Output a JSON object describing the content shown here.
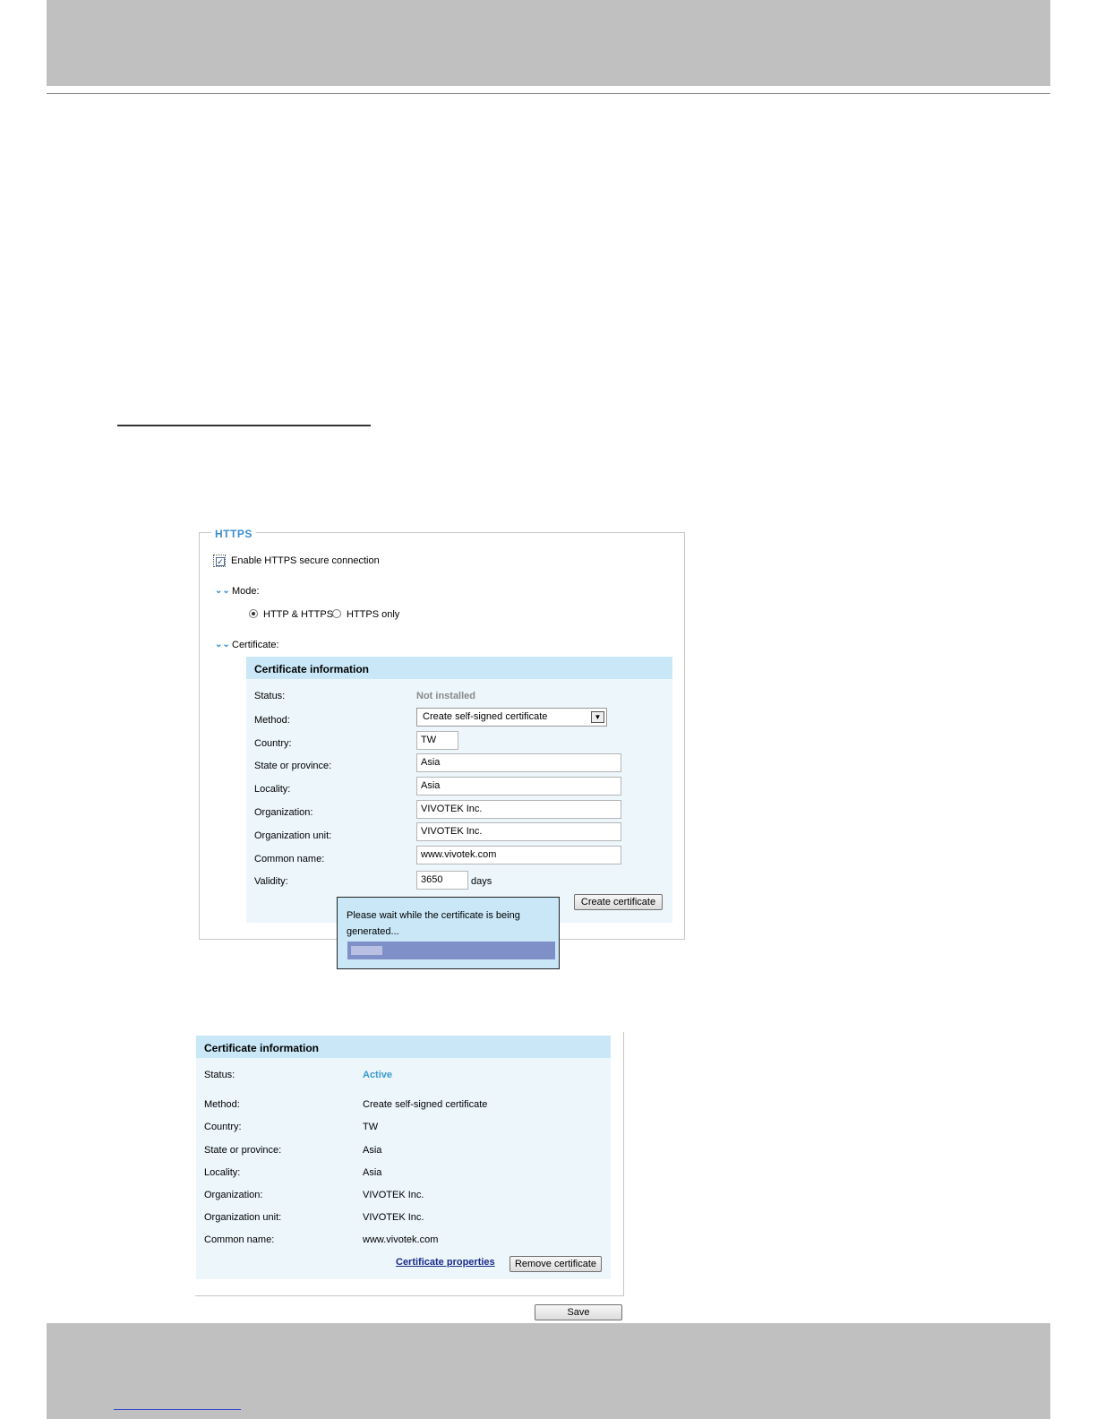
{
  "https": {
    "legend": "HTTPS",
    "enable_label": "Enable HTTPS secure connection",
    "enable_checked": true,
    "mode_label": "Mode:",
    "mode_options": [
      "HTTP & HTTPS",
      "HTTPS only"
    ],
    "mode_selected": "HTTP & HTTPS",
    "certificate_label": "Certificate:",
    "cert_info": {
      "title": "Certificate information",
      "status_label": "Status:",
      "status_value": "Not installed",
      "method_label": "Method:",
      "method_value": "Create self-signed certificate",
      "country_label": "Country:",
      "country_value": "TW",
      "state_label": "State or province:",
      "state_value": "Asia",
      "locality_label": "Locality:",
      "locality_value": "Asia",
      "org_label": "Organization:",
      "org_value": "VIVOTEK Inc.",
      "orgunit_label": "Organization unit:",
      "orgunit_value": "VIVOTEK Inc.",
      "common_label": "Common name:",
      "common_value": "www.vivotek.com",
      "validity_label": "Validity:",
      "validity_value": "3650",
      "validity_unit": "days",
      "create_button": "Create certificate"
    },
    "popup": {
      "line1": "Please wait while the certificate is being",
      "line2": "generated..."
    }
  },
  "cert_result": {
    "title": "Certificate information",
    "status_label": "Status:",
    "status_value": "Active",
    "method_label": "Method:",
    "method_value": "Create self-signed certificate",
    "country_label": "Country:",
    "country_value": "TW",
    "state_label": "State or province:",
    "state_value": "Asia",
    "locality_label": "Locality:",
    "locality_value": "Asia",
    "org_label": "Organization:",
    "org_value": "VIVOTEK Inc.",
    "orgunit_label": "Organization unit:",
    "orgunit_value": "VIVOTEK Inc.",
    "common_label": "Common name:",
    "common_value": "www.vivotek.com",
    "properties_link": "Certificate properties",
    "remove_button": "Remove certificate",
    "save_button": "Save"
  },
  "colors": {
    "header_band": "#c0c0c0",
    "accent_blue": "#3a8fd0",
    "panel_bg": "#ecf6fb",
    "panel_head": "#c9e7f7"
  }
}
